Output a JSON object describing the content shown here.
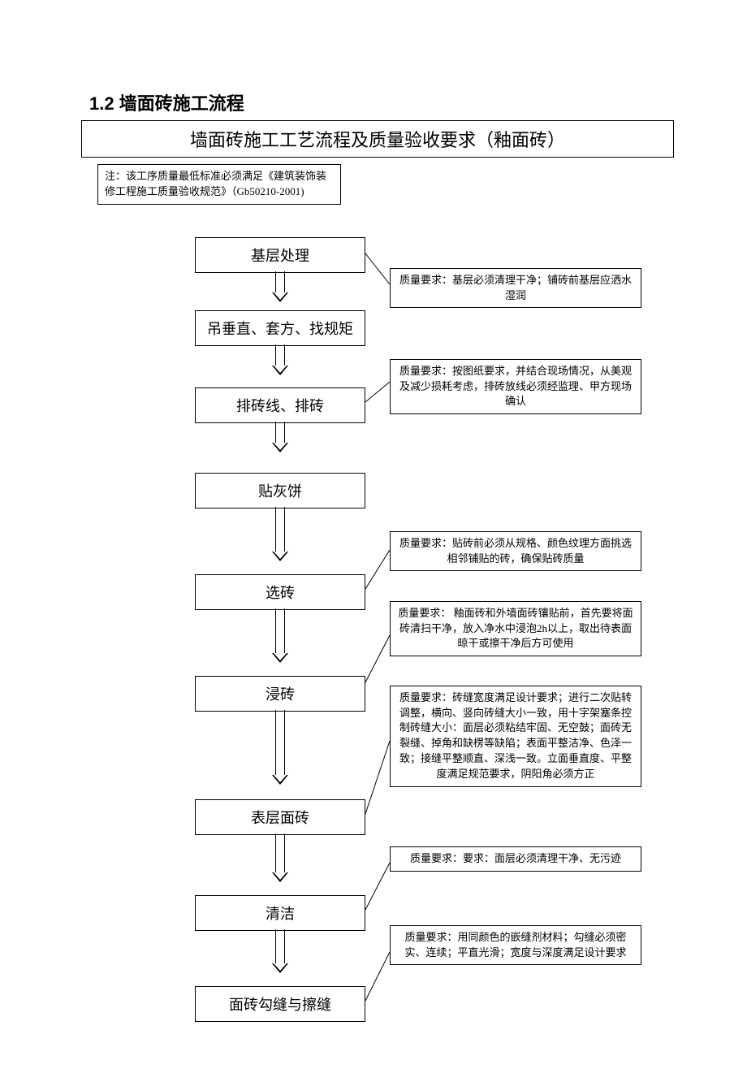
{
  "heading": "1.2 墙面砖施工流程",
  "title": "墙面砖施工工艺流程及质量验收要求（釉面砖）",
  "note": "注：该工序质量最低标准必须满足《建筑装饰装修工程施工质量验收规范》（Gb50210-2001)",
  "steps": {
    "s1": "基层处理",
    "s2": "吊垂直、套方、找规矩",
    "s3": "排砖线、排砖",
    "s4": "贴灰饼",
    "s5": "选砖",
    "s6": "浸砖",
    "s7": "表层面砖",
    "s8": "清洁",
    "s9": "面砖勾缝与擦缝"
  },
  "reqs": {
    "r1": "质量要求：基层必须清理干净；铺砖前基层应洒水湿润",
    "r3": "质量要求：按图纸要求，并结合现场情况，从美观及减少损耗考虑，排砖放线必须经监理、甲方现场确认",
    "r5": "质量要求：贴砖前必须从规格、颜色纹理方面挑选相邻铺贴的砖，确保贴砖质量",
    "r6a": "质量要求：\n釉面砖和外墙面砖镶贴前，首先要将面砖清扫干净，放入净水中浸泡2h以上，取出待表面晾干或擦干净后方可使用",
    "r6b": "质量要求：砖缝宽度满足设计要求；进行二次贴转调整，横向、竖向砖缝大小一致，用十字架塞条控制砖缝大小：面层必须粘结牢固、无空鼓；面砖无裂缝、掉角和缺楞等缺陷；表面平整洁净、色泽一致；接缝平整顺直、深浅一致。立面垂直度、平整度满足规范要求，阴阳角必须方正",
    "r8": "质量要求：要求：面层必须清理干净、无污迹",
    "r9": "质量要求：用同颜色的嵌缝剂材料；勾缝必须密实、连续；平直光滑；宽度与深度满足设计要求"
  }
}
